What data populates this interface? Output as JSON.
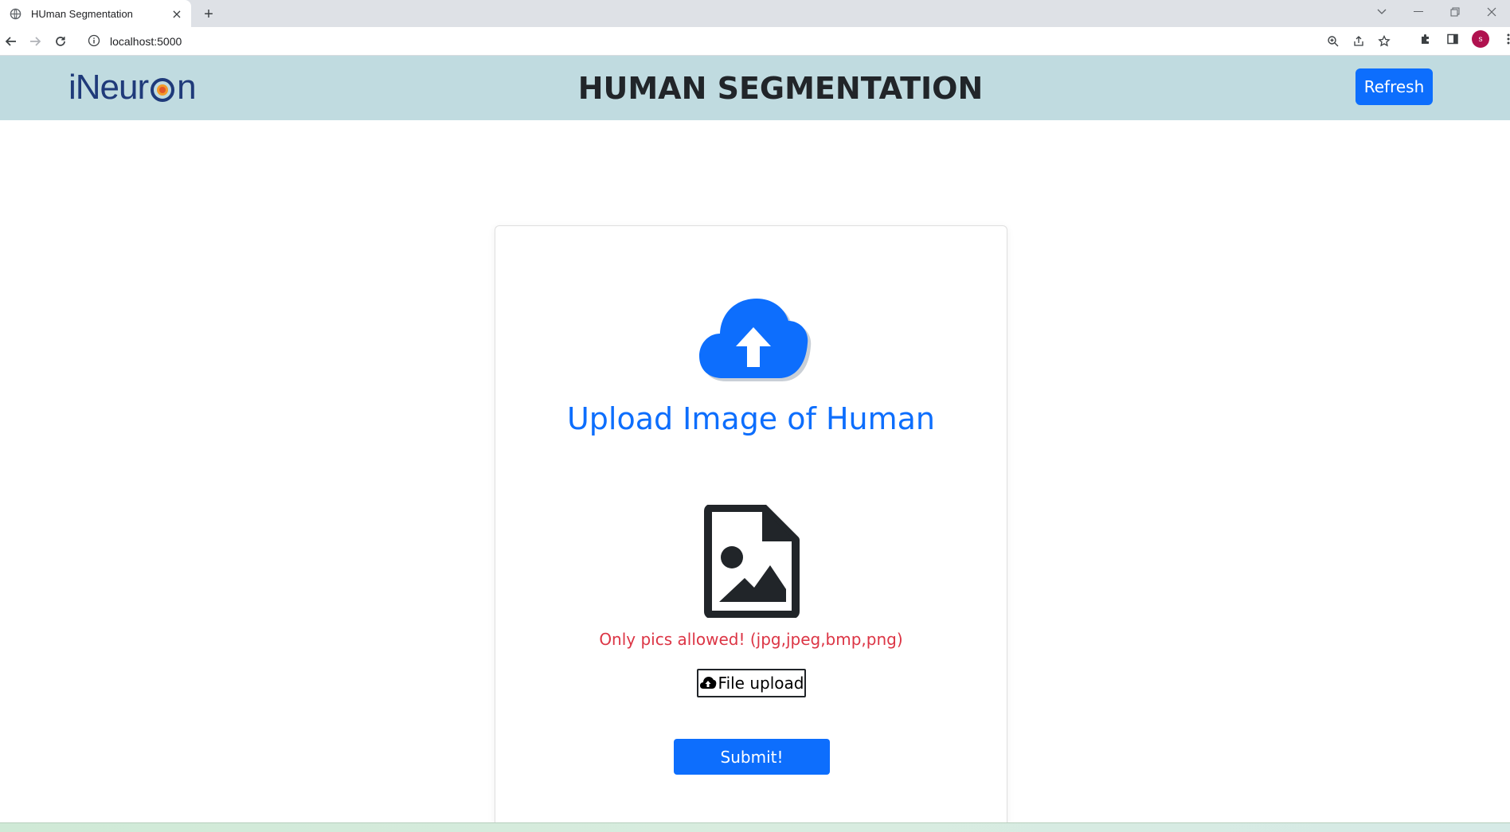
{
  "browser": {
    "tab_title": "HUman Segmentation",
    "tab_close": "×",
    "new_tab": "+",
    "url": "localhost:5000",
    "avatar_initial": "s"
  },
  "header": {
    "logo_text_left": "iNeur",
    "logo_text_right": "n",
    "title": "HUMAN SEGMENTATION",
    "refresh_label": "Refresh"
  },
  "card": {
    "heading": "Upload Image of Human",
    "note": "Only pics allowed! (jpg,jpeg,bmp,png)",
    "file_upload_label": "File upload",
    "submit_label": "Submit!"
  },
  "colors": {
    "header_bg": "#c0dbe0",
    "primary": "#0d6efd",
    "danger": "#dc3545",
    "dark": "#212529"
  }
}
